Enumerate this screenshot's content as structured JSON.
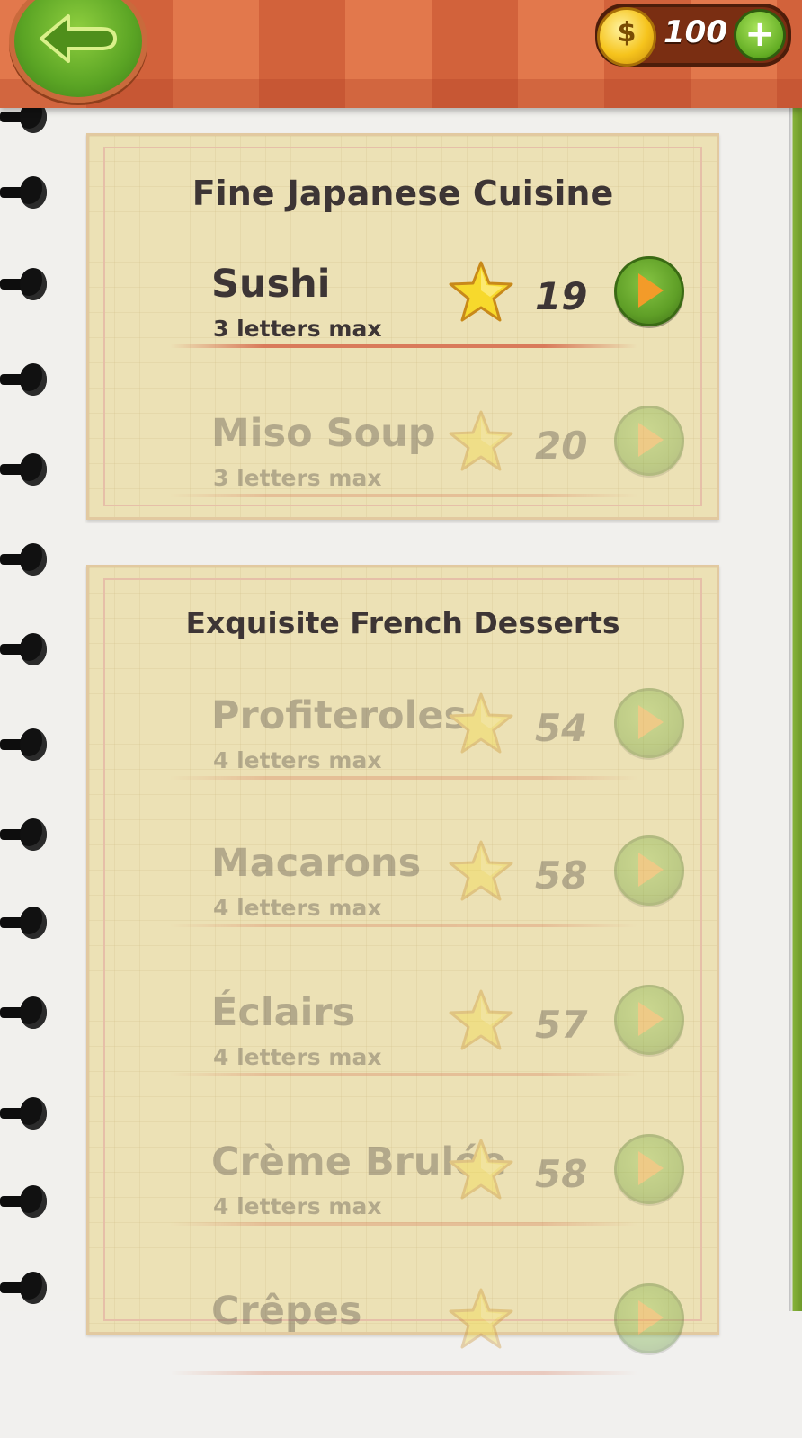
{
  "header": {
    "back_label": "Back",
    "coin_symbol": "$",
    "coins": "100",
    "add_coins_symbol": "+"
  },
  "colors": {
    "header_orange": "#e2784c",
    "header_dark": "#d2623b",
    "card_bg": "#ece1b5",
    "play_green": "#5f9f27",
    "star_yellow": "#f7d92c",
    "text_dark": "#3d3535"
  },
  "icons": {
    "back": "back-arrow-icon",
    "coin": "dollar-coin-icon",
    "add": "plus-icon",
    "star": "star-icon",
    "play": "play-icon"
  },
  "categories": [
    {
      "title": "Fine Japanese Cuisine",
      "items": [
        {
          "name": "Sushi",
          "subtitle": "3 letters max",
          "score": "19",
          "locked": false
        },
        {
          "name": "Miso Soup",
          "subtitle": "3 letters max",
          "score": "20",
          "locked": true
        }
      ]
    },
    {
      "title": "Exquisite French Desserts",
      "items": [
        {
          "name": "Profiteroles",
          "subtitle": "4 letters max",
          "score": "54",
          "locked": true
        },
        {
          "name": "Macarons",
          "subtitle": "4 letters max",
          "score": "58",
          "locked": true
        },
        {
          "name": "Éclairs",
          "subtitle": "4 letters max",
          "score": "57",
          "locked": true
        },
        {
          "name": "Crème Brulée",
          "subtitle": "4 letters max",
          "score": "58",
          "locked": true
        },
        {
          "name": "Crêpes",
          "subtitle": "",
          "score": "",
          "locked": true
        }
      ]
    }
  ]
}
